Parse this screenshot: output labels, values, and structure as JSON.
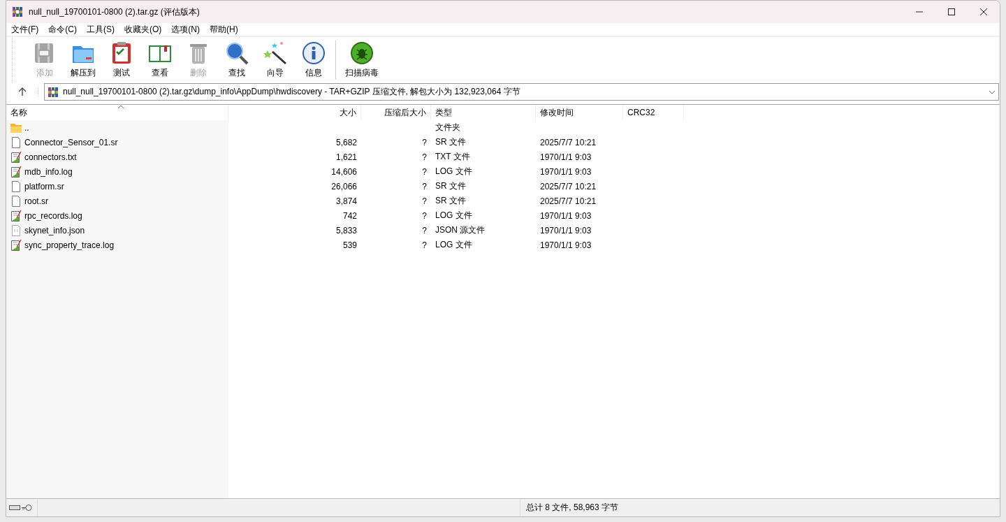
{
  "window": {
    "title": "null_null_19700101-0800 (2).tar.gz (评估版本)"
  },
  "menu": [
    "文件(F)",
    "命令(C)",
    "工具(S)",
    "收藏夹(O)",
    "选项(N)",
    "帮助(H)"
  ],
  "toolbar": [
    {
      "kind": "add",
      "label": "添加",
      "disabled": true
    },
    {
      "kind": "extract",
      "label": "解压到",
      "disabled": false
    },
    {
      "kind": "test",
      "label": "测试",
      "disabled": false
    },
    {
      "kind": "view",
      "label": "查看",
      "disabled": false
    },
    {
      "kind": "delete",
      "label": "删除",
      "disabled": true
    },
    {
      "kind": "find",
      "label": "查找",
      "disabled": false
    },
    {
      "kind": "wizard",
      "label": "向导",
      "disabled": false
    },
    {
      "kind": "info",
      "label": "信息",
      "disabled": false
    },
    {
      "kind": "scan",
      "label": "扫描病毒",
      "disabled": false
    }
  ],
  "address": {
    "value": "null_null_19700101-0800 (2).tar.gz\\dump_info\\AppDump\\hwdiscovery - TAR+GZIP 压缩文件, 解包大小为 132,923,064 字节"
  },
  "table": {
    "columns": [
      {
        "label": "名称",
        "kind": "text",
        "sorted": true
      },
      {
        "label": "大小",
        "kind": "number",
        "sorted": false
      },
      {
        "label": "压缩后大小",
        "kind": "number",
        "sorted": false
      },
      {
        "label": "类型",
        "kind": "text",
        "sorted": false
      },
      {
        "label": "修改时间",
        "kind": "text",
        "sorted": false
      },
      {
        "label": "CRC32",
        "kind": "text",
        "sorted": false
      }
    ],
    "rows": [
      {
        "kind": "folder",
        "cells": [
          "..",
          "",
          "",
          "文件夹",
          "",
          ""
        ]
      },
      {
        "kind": "blank",
        "cells": [
          "Connector_Sensor_01.sr",
          "5,682",
          "?",
          "SR 文件",
          "2025/7/7 10:21",
          ""
        ]
      },
      {
        "kind": "text",
        "cells": [
          "connectors.txt",
          "1,621",
          "?",
          "TXT 文件",
          "1970/1/1 9:03",
          ""
        ]
      },
      {
        "kind": "text",
        "cells": [
          "mdb_info.log",
          "14,606",
          "?",
          "LOG 文件",
          "1970/1/1 9:03",
          ""
        ]
      },
      {
        "kind": "blank",
        "cells": [
          "platform.sr",
          "26,066",
          "?",
          "SR 文件",
          "2025/7/7 10:21",
          ""
        ]
      },
      {
        "kind": "blank",
        "cells": [
          "root.sr",
          "3,874",
          "?",
          "SR 文件",
          "2025/7/7 10:21",
          ""
        ]
      },
      {
        "kind": "text",
        "cells": [
          "rpc_records.log",
          "742",
          "?",
          "LOG 文件",
          "1970/1/1 9:03",
          ""
        ]
      },
      {
        "kind": "json",
        "cells": [
          "skynet_info.json",
          "5,833",
          "?",
          "JSON 源文件",
          "1970/1/1 9:03",
          ""
        ]
      },
      {
        "kind": "text",
        "cells": [
          "sync_property_trace.log",
          "539",
          "?",
          "LOG 文件",
          "1970/1/1 9:03",
          ""
        ]
      }
    ]
  },
  "status_bar": {
    "text": "总计 8 文件, 58,963 字节"
  }
}
